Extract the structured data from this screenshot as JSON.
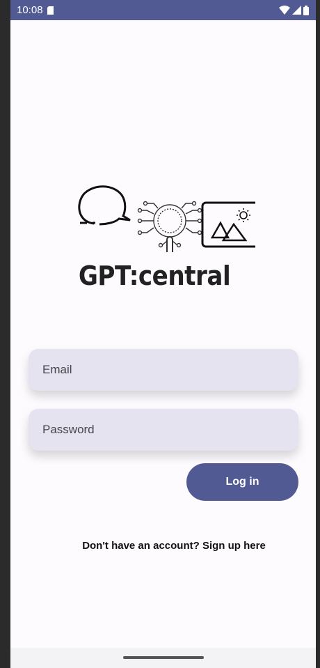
{
  "status_bar": {
    "time": "10:08",
    "icons": [
      "sd-card-icon",
      "wifi-icon",
      "signal-icon",
      "battery-icon"
    ]
  },
  "logo": {
    "title": "GPT:central",
    "icons": [
      "speech-bubble-icon",
      "magnifier-network-icon",
      "image-icon",
      "sun-icon"
    ]
  },
  "form": {
    "email_placeholder": "Email",
    "password_placeholder": "Password",
    "login_label": "Log in"
  },
  "signup": {
    "text": "Don't have an account? Sign up here"
  },
  "colors": {
    "accent": "#525a94",
    "field_bg": "#e4e3ef",
    "background": "#fdfbfe"
  }
}
